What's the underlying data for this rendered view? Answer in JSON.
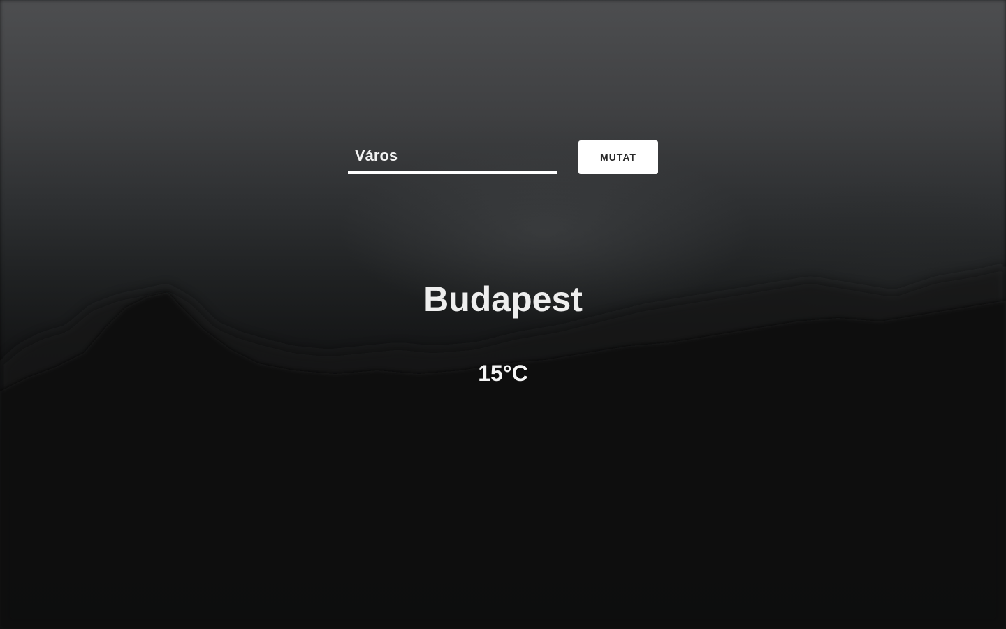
{
  "search": {
    "placeholder": "Város",
    "value": ""
  },
  "actions": {
    "show_label": "MUTAT"
  },
  "weather": {
    "city": "Budapest",
    "temperature": "15°C"
  },
  "colors": {
    "text": "#ffffff",
    "button_background": "#ffffff",
    "button_text": "#2a2a2a",
    "background_top": "#4d4e50",
    "background_bottom": "#0d0e0f"
  }
}
